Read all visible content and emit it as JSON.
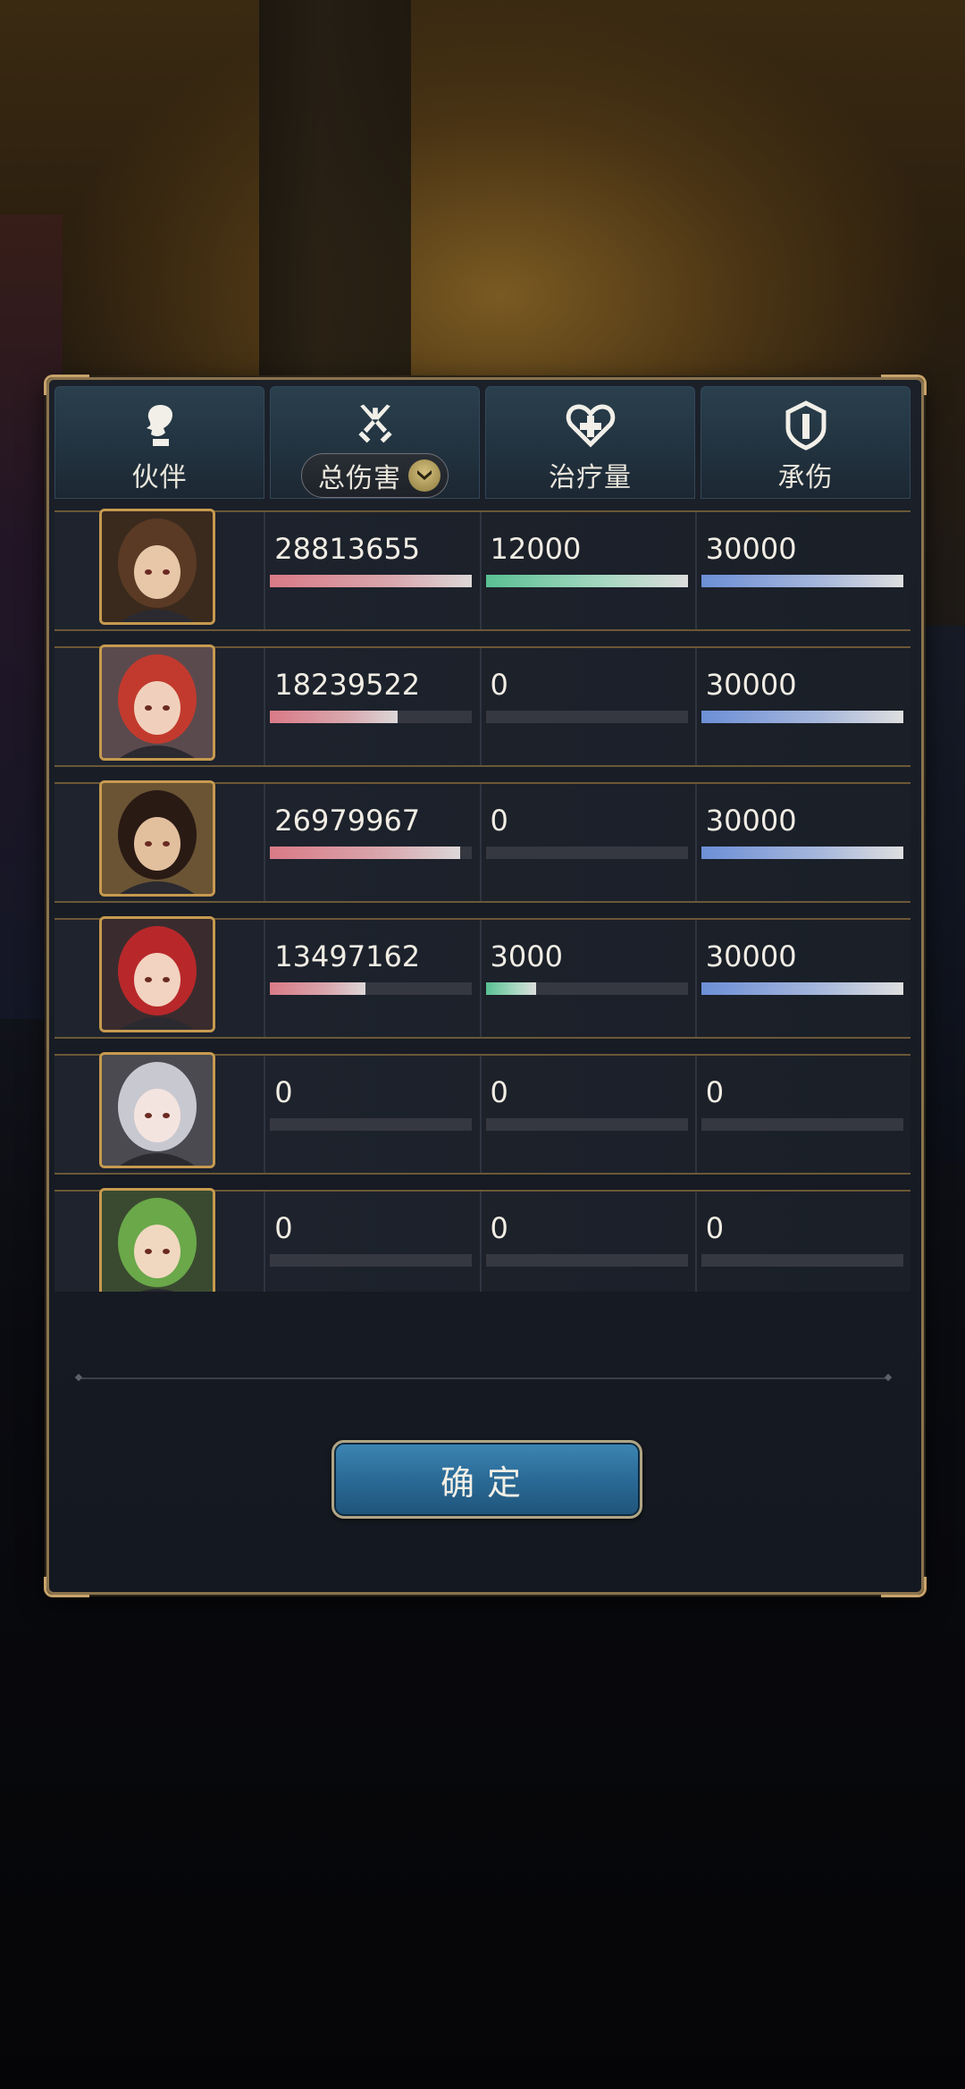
{
  "tabs": [
    {
      "label": "伙伴",
      "icon": "silhouette-icon"
    },
    {
      "label": "总伤害",
      "icon": "crossed-swords-icon",
      "active": true
    },
    {
      "label": "治疗量",
      "icon": "heart-cross-icon"
    },
    {
      "label": "承伤",
      "icon": "shield-icon"
    }
  ],
  "rows": [
    {
      "damage": "28813655",
      "damage_frac": 1.0,
      "healing": "12000",
      "healing_frac": 1.0,
      "taken": "30000",
      "taken_frac": 1.0,
      "portrait": {
        "hair": "#5a3a24",
        "skin": "#e8c7a8",
        "bg": "#3a2a1e"
      }
    },
    {
      "damage": "18239522",
      "damage_frac": 0.63,
      "healing": "0",
      "healing_frac": 0.0,
      "taken": "30000",
      "taken_frac": 1.0,
      "portrait": {
        "hair": "#c23a2e",
        "skin": "#f0d0bc",
        "bg": "#5a4a4e"
      }
    },
    {
      "damage": "26979967",
      "damage_frac": 0.94,
      "healing": "0",
      "healing_frac": 0.0,
      "taken": "30000",
      "taken_frac": 1.0,
      "portrait": {
        "hair": "#2a1a14",
        "skin": "#e2c09e",
        "bg": "#6a5434"
      }
    },
    {
      "damage": "13497162",
      "damage_frac": 0.47,
      "healing": "3000",
      "healing_frac": 0.25,
      "taken": "30000",
      "taken_frac": 1.0,
      "portrait": {
        "hair": "#b8282a",
        "skin": "#f2d2c0",
        "bg": "#3a2c2e"
      }
    },
    {
      "damage": "0",
      "damage_frac": 0.0,
      "healing": "0",
      "healing_frac": 0.0,
      "taken": "0",
      "taken_frac": 0.0,
      "portrait": {
        "hair": "#c8c8d0",
        "skin": "#f4e4e0",
        "bg": "#4a4a50"
      }
    },
    {
      "damage": "0",
      "damage_frac": 0.0,
      "healing": "0",
      "healing_frac": 0.0,
      "taken": "0",
      "taken_frac": 0.0,
      "portrait": {
        "hair": "#6aa84a",
        "skin": "#f0d8c0",
        "bg": "#3a4a30"
      }
    }
  ],
  "confirm_label": "确定"
}
